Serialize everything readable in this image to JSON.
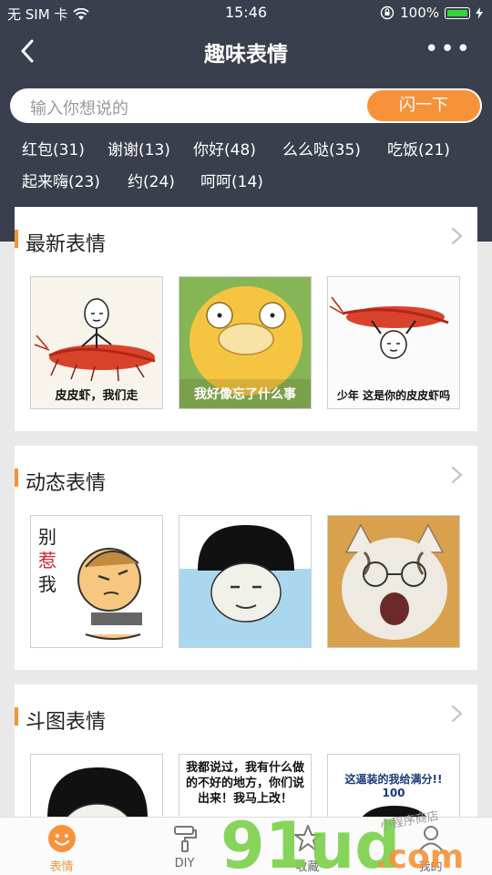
{
  "status": {
    "carrier": "无 SIM 卡",
    "time": "15:46",
    "battery": "100%"
  },
  "nav": {
    "title": "趣味表情"
  },
  "search": {
    "placeholder": "输入你想说的",
    "button": "闪一下"
  },
  "tags": [
    "红包(31)",
    "谢谢(13)",
    "你好(48)",
    "么么哒(35)",
    "吃饭(21)",
    "起来嗨(23)",
    "约(24)",
    "呵呵(14)"
  ],
  "sections": [
    {
      "title": "最新表情",
      "captions": [
        "皮皮虾，我们走",
        "我好像忘了什么事",
        "少年 这是你的皮皮虾吗"
      ]
    },
    {
      "title": "动态表情",
      "captions": [
        "别惹我",
        "",
        ""
      ]
    },
    {
      "title": "斗图表情",
      "captions": [
        "",
        "我都说过，我有什么做的不好的地方，你们说出来！我马上改！",
        "这逼装的我给满分!! 100"
      ]
    }
  ],
  "tabs": [
    {
      "label": "表情",
      "icon": "smiley-icon",
      "active": true
    },
    {
      "label": "DIY",
      "icon": "paint-roller-icon",
      "active": false
    },
    {
      "label": "收藏",
      "icon": "star-icon",
      "active": false
    },
    {
      "label": "我的",
      "icon": "person-icon",
      "active": false
    }
  ],
  "watermark": {
    "text": "91ud.com",
    "sub": "小程序商店"
  },
  "colors": {
    "header": "#393f4c",
    "accent": "#f7923a"
  }
}
